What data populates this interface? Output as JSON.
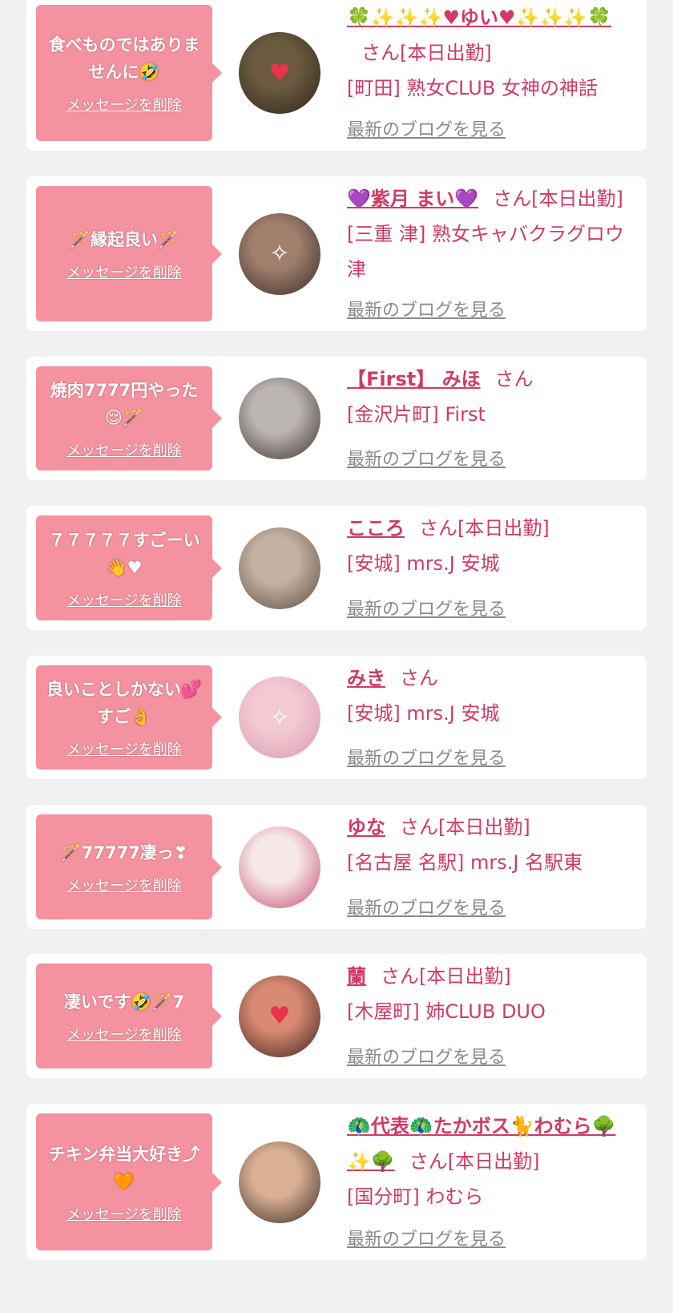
{
  "ui": {
    "delete_label": "メッセージを削除",
    "blog_label": "最新のブログを見る",
    "accent": "#d13a66",
    "bubble_color": "#f4939f",
    "background": "#f1f1f1"
  },
  "cards": [
    {
      "message": "食べものではありませんに🤣",
      "name": "🍀✨✨✨♥ゆい♥✨✨✨🍀",
      "suffix": "さん[本日出勤]",
      "shop": "[町田] 熟女CLUB 女神の神話",
      "avatar_colors": [
        "#6b5a40",
        "#2c241b"
      ],
      "avatar_icon": "heart-icon"
    },
    {
      "message": "🪄縁起良い🪄",
      "name": "💜紫月 まい💜",
      "suffix": "さん[本日出勤]",
      "shop": "[三重 津] 熟女キャバクラグロウ津",
      "avatar_colors": [
        "#a07f6d",
        "#3a2c28"
      ],
      "avatar_icon": "sparkle-icon"
    },
    {
      "message": "焼肉7777円やった😌🪄",
      "name": "【First】 みほ",
      "suffix": "さん",
      "shop": "[金沢片町] First",
      "avatar_colors": [
        "#bcb6b2",
        "#3a312c"
      ],
      "avatar_icon": "person-icon"
    },
    {
      "message": "７７７７７すごーい👋♥",
      "name": "こころ",
      "suffix": "さん[本日出勤]",
      "shop": "[安城] mrs.J 安城",
      "avatar_colors": [
        "#c4b1a2",
        "#5c4b40"
      ],
      "avatar_icon": "person-icon"
    },
    {
      "message": "良いことしかない💕すご👌",
      "name": "みき",
      "suffix": "さん",
      "shop": "[安城] mrs.J 安城",
      "avatar_colors": [
        "#f3c9d3",
        "#d79bb0"
      ],
      "avatar_icon": "sparkle-icon"
    },
    {
      "message": "🪄77777凄っ❣",
      "name": "ゆな",
      "suffix": "さん[本日出勤]",
      "shop": "[名古屋 名駅] mrs.J 名駅東",
      "avatar_colors": [
        "#f6e8e9",
        "#c44c6b"
      ],
      "avatar_icon": "person-icon"
    },
    {
      "message": "凄いです🤣🪄7",
      "name": "蘭",
      "suffix": "さん[本日出勤]",
      "shop": "[木屋町] 姉CLUB DUO",
      "avatar_colors": [
        "#d98a74",
        "#3b221c"
      ],
      "avatar_icon": "heart-icon"
    },
    {
      "message": "チキン弁当大好き⤴🧡",
      "name": "🦚代表🦚たかボス🐈わむら🌳✨🌳",
      "suffix": "さん[本日出勤]",
      "shop": "[国分町] わむら",
      "avatar_colors": [
        "#d9b094",
        "#3a2a22"
      ],
      "avatar_icon": "person-icon"
    }
  ]
}
